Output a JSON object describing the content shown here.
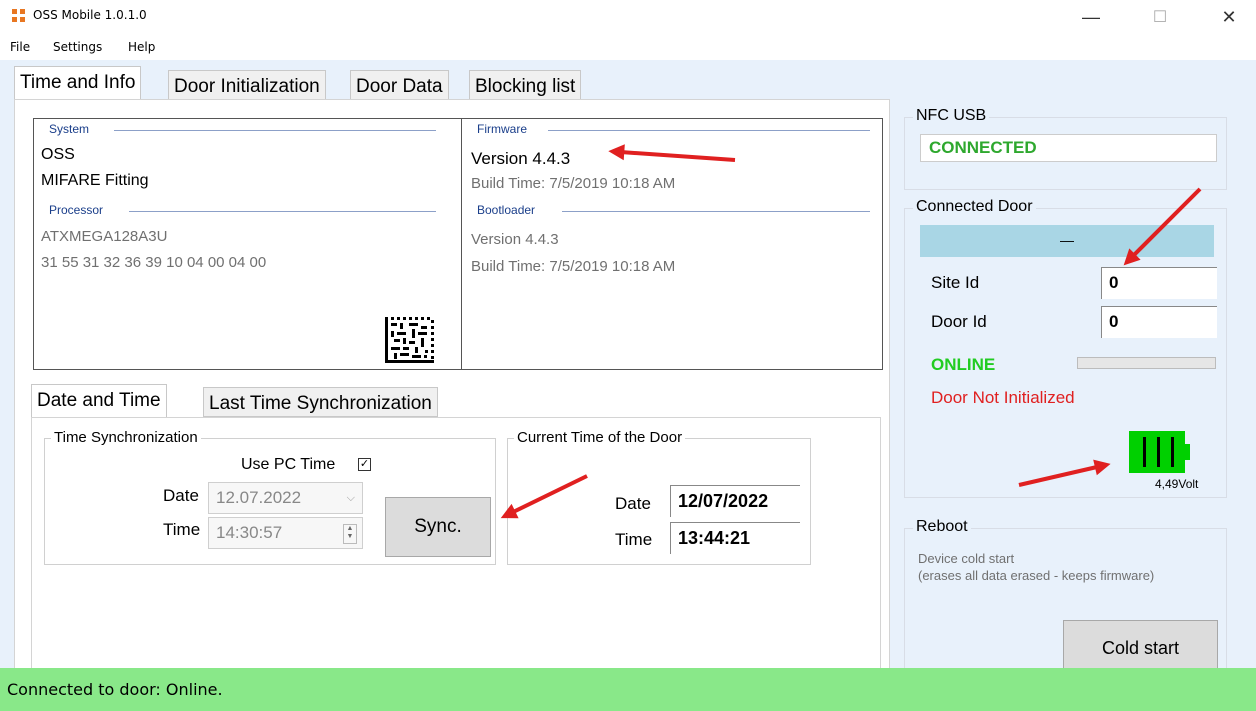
{
  "window": {
    "title": "OSS Mobile 1.0.1.0",
    "minimize_glyph": "—",
    "maximize_glyph": "☐",
    "close_glyph": "✕"
  },
  "menu": {
    "file": "File",
    "settings": "Settings",
    "help": "Help"
  },
  "tabs": [
    "Time and Info",
    "Door Initialization",
    "Door Data",
    "Blocking list"
  ],
  "system": {
    "legend": "System",
    "line1": "OSS",
    "line2": "MIFARE Fitting",
    "processor_legend": "Processor",
    "processor": "ATXMEGA128A3U",
    "serial": "31 55 31 32 36 39 10 04 00 04 00"
  },
  "firmware": {
    "legend": "Firmware",
    "version": "Version  4.4.3",
    "build": "Build Time:  7/5/2019 10:18 AM",
    "bootloader_legend": "Bootloader",
    "boot_version": "Version  4.4.3",
    "boot_build": "Build Time:  7/5/2019 10:18 AM"
  },
  "subtabs": [
    "Date and Time",
    "Last Time Synchronization"
  ],
  "time_sync": {
    "legend": "Time Synchronization",
    "use_pc_time": "Use PC Time",
    "date_label": "Date",
    "date_value": "12.07.2022",
    "time_label": "Time",
    "time_value": "14:30:57",
    "sync_button": "Sync."
  },
  "door_time": {
    "legend": "Current Time of the Door",
    "date_label": "Date",
    "date_value": "12/07/2022",
    "time_label": "Time",
    "time_value": "13:44:21"
  },
  "nfc": {
    "legend": "NFC USB",
    "status": "CONNECTED"
  },
  "door": {
    "legend": "Connected Door",
    "name": "—",
    "site_label": "Site Id",
    "site_value": "0",
    "door_label": "Door Id",
    "door_value": "0",
    "online": "ONLINE",
    "init_status": "Door Not Initialized",
    "battery_level": 1.0,
    "battery_text": "4,49Volt"
  },
  "reboot": {
    "legend": "Reboot",
    "desc1": "Device cold start",
    "desc2": "(erases all data erased - keeps firmware)",
    "button": "Cold start"
  },
  "status": "Connected to door: Online.",
  "colors": {
    "status_bar": "#89e889",
    "online": "#22cc22",
    "error": "#e02020",
    "connected": "#2ea82e",
    "battery": "#00d000"
  }
}
